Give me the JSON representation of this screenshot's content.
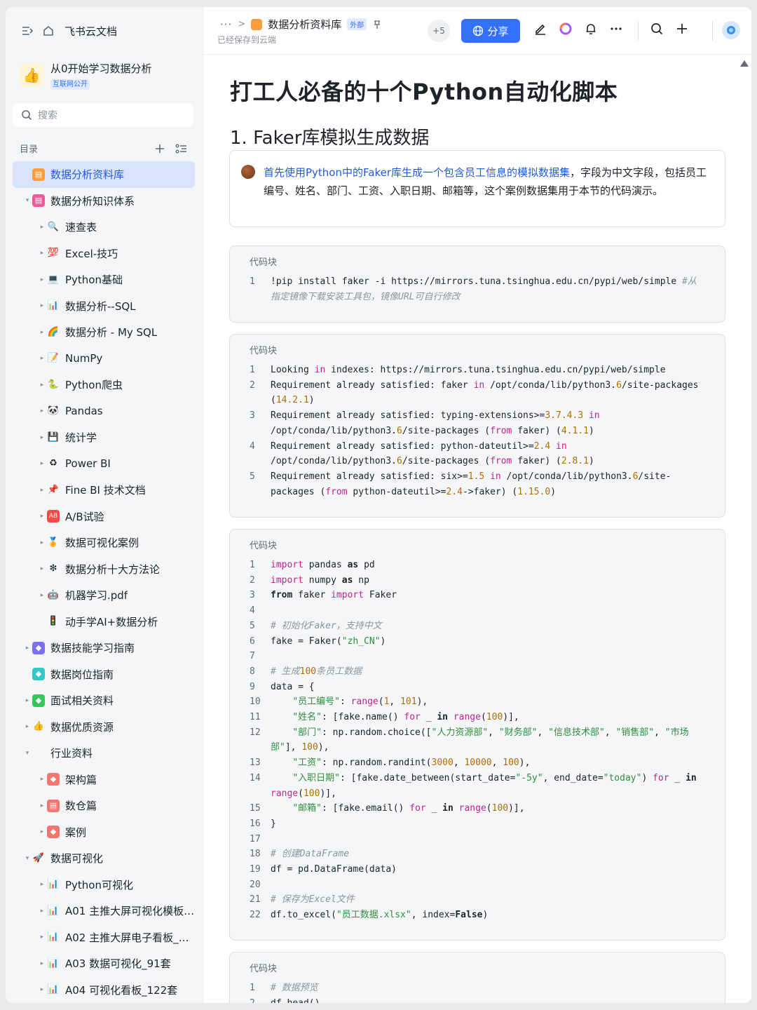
{
  "sidebar": {
    "brand": "飞书云文档",
    "space_title": "从0开始学习数据分析",
    "space_tag": "互联网公开",
    "search_placeholder": "搜索",
    "toc_label": "目录",
    "items": [
      {
        "label": "数据分析资料库",
        "level": 0,
        "caret": "",
        "emoji": "▤",
        "emoji_bg": "#ff9d3c",
        "active": true
      },
      {
        "label": "数据分析知识体系",
        "level": 0,
        "caret": "▾",
        "emoji": "▤",
        "emoji_bg": "#f05a9a",
        "active": false
      },
      {
        "label": "速查表",
        "level": 1,
        "caret": "▸",
        "emoji": "🔍",
        "emoji_bg": "",
        "active": false
      },
      {
        "label": "Excel-技巧",
        "level": 1,
        "caret": "▸",
        "emoji": "💯",
        "emoji_bg": "",
        "active": false
      },
      {
        "label": "Python基础",
        "level": 1,
        "caret": "▸",
        "emoji": "💻",
        "emoji_bg": "",
        "active": false
      },
      {
        "label": "数据分析--SQL",
        "level": 1,
        "caret": "▸",
        "emoji": "📊",
        "emoji_bg": "",
        "active": false
      },
      {
        "label": "数据分析 - My SQL",
        "level": 1,
        "caret": "▸",
        "emoji": "🌈",
        "emoji_bg": "",
        "active": false
      },
      {
        "label": "NumPy",
        "level": 1,
        "caret": "▸",
        "emoji": "📝",
        "emoji_bg": "",
        "active": false
      },
      {
        "label": "Python爬虫",
        "level": 1,
        "caret": "▸",
        "emoji": "🐍",
        "emoji_bg": "",
        "active": false
      },
      {
        "label": "Pandas",
        "level": 1,
        "caret": "▸",
        "emoji": "🐼",
        "emoji_bg": "",
        "active": false
      },
      {
        "label": "统计学",
        "level": 1,
        "caret": "▸",
        "emoji": "💾",
        "emoji_bg": "",
        "active": false
      },
      {
        "label": "Power BI",
        "level": 1,
        "caret": "▸",
        "emoji": "♻",
        "emoji_bg": "",
        "active": false
      },
      {
        "label": "Fine BI 技术文档",
        "level": 1,
        "caret": "▸",
        "emoji": "📌",
        "emoji_bg": "",
        "active": false
      },
      {
        "label": "A/B试验",
        "level": 1,
        "caret": "▸",
        "emoji": "AB",
        "emoji_bg": "#f54a45",
        "active": false
      },
      {
        "label": "数据可视化案例",
        "level": 1,
        "caret": "▸",
        "emoji": "🏅",
        "emoji_bg": "",
        "active": false
      },
      {
        "label": "数据分析十大方法论",
        "level": 1,
        "caret": "▸",
        "emoji": "❇",
        "emoji_bg": "",
        "active": false
      },
      {
        "label": "机器学习.pdf",
        "level": 1,
        "caret": "▸",
        "emoji": "🤖",
        "emoji_bg": "",
        "active": false
      },
      {
        "label": "动手学AI+数据分析",
        "level": 1,
        "caret": "",
        "emoji": "🚦",
        "emoji_bg": "",
        "active": false
      },
      {
        "label": "数据技能学习指南",
        "level": 0,
        "caret": "▸",
        "emoji": "◆",
        "emoji_bg": "#7f6ef5",
        "active": false
      },
      {
        "label": "数据岗位指南",
        "level": 0,
        "caret": "",
        "emoji": "◆",
        "emoji_bg": "#34c7c7",
        "active": false
      },
      {
        "label": "面试相关资料",
        "level": 0,
        "caret": "▸",
        "emoji": "◆",
        "emoji_bg": "#34c759",
        "active": false
      },
      {
        "label": "数据优质资源",
        "level": 0,
        "caret": "▸",
        "emoji": "👍",
        "emoji_bg": "",
        "active": false
      },
      {
        "label": "行业资料",
        "level": 0,
        "caret": "▾",
        "emoji": "",
        "emoji_bg": "",
        "active": false
      },
      {
        "label": "架构篇",
        "level": 1,
        "caret": "▸",
        "emoji": "◆",
        "emoji_bg": "#f5766e",
        "active": false
      },
      {
        "label": "数仓篇",
        "level": 1,
        "caret": "▸",
        "emoji": "▤",
        "emoji_bg": "#f5766e",
        "active": false
      },
      {
        "label": "案例",
        "level": 1,
        "caret": "▸",
        "emoji": "◆",
        "emoji_bg": "#f5766e",
        "active": false
      },
      {
        "label": "数据可视化",
        "level": 0,
        "caret": "▾",
        "emoji": "🚀",
        "emoji_bg": "",
        "active": false
      },
      {
        "label": "Python可视化",
        "level": 1,
        "caret": "▸",
        "emoji": "📊",
        "emoji_bg": "",
        "active": false
      },
      {
        "label": "A01 主推大屏可视化模板_...",
        "level": 1,
        "caret": "▸",
        "emoji": "📊",
        "emoji_bg": "",
        "active": false
      },
      {
        "label": "A02 主推大屏电子看板_20套",
        "level": 1,
        "caret": "▸",
        "emoji": "📊",
        "emoji_bg": "",
        "active": false
      },
      {
        "label": "A03 数据可视化_91套",
        "level": 1,
        "caret": "▸",
        "emoji": "📊",
        "emoji_bg": "",
        "active": false
      },
      {
        "label": "A04 可视化看板_122套",
        "level": 1,
        "caret": "▸",
        "emoji": "📊",
        "emoji_bg": "",
        "active": false
      }
    ]
  },
  "header": {
    "more": "···",
    "breadcrumb_title": "数据分析资料库",
    "external_tag": "外部",
    "saved_status": "已经保存到云端",
    "collaborators": "+5",
    "share_label": "分享"
  },
  "doc": {
    "title": "打工人必备的十个Python自动化脚本",
    "heading": "1. Faker库模拟生成数据",
    "callout_link": "首先使用Python中的Faker库生成一个包含员工信息的模拟数据集",
    "callout_rest": "，字段为中文字段，包括员工编号、姓名、部门、工资、入职日期、邮箱等，这个案例数据集用于本节的代码演示。",
    "code_title": "代码块"
  },
  "colors": {
    "accent": "#3370ff",
    "keyword": "#c0258f",
    "string": "#2f8f3d",
    "number": "#b26f00",
    "comment": "#8f959e"
  },
  "code_blocks": [
    {
      "lines": [
        {
          "n": "1",
          "t": [
            [
              "!pip install faker -i https://mirrors.tuna.tsinghua.edu.cn/pypi/web/simple ",
              ""
            ],
            [
              "#从指定镜像下载安装工具包，镜像URL可自行修改",
              "cm"
            ]
          ]
        }
      ]
    },
    {
      "lines": [
        {
          "n": "1",
          "t": [
            [
              "Looking ",
              ""
            ],
            [
              "in",
              "kw"
            ],
            [
              " indexes: https://mirrors.tuna.tsinghua.edu.cn/pypi/web/simple",
              ""
            ]
          ]
        },
        {
          "n": "2",
          "t": [
            [
              "Requirement already satisfied: faker ",
              ""
            ],
            [
              "in",
              "kw"
            ],
            [
              " /opt/conda/lib/python3.",
              ""
            ],
            [
              "6",
              "num"
            ],
            [
              "/site-packages (",
              ""
            ],
            [
              "14.2.1",
              "num"
            ],
            [
              ")",
              ""
            ]
          ]
        },
        {
          "n": "3",
          "t": [
            [
              "Requirement already satisfied: typing-extensions>=",
              ""
            ],
            [
              "3.7.4.3",
              "num"
            ],
            [
              " ",
              ""
            ],
            [
              "in",
              "kw"
            ],
            [
              " /opt/conda/lib/python3.",
              ""
            ],
            [
              "6",
              "num"
            ],
            [
              "/site-packages (",
              ""
            ],
            [
              "from",
              "kw"
            ],
            [
              " faker) (",
              ""
            ],
            [
              "4.1.1",
              "num"
            ],
            [
              ")",
              ""
            ]
          ]
        },
        {
          "n": "4",
          "t": [
            [
              "Requirement already satisfied: python-dateutil>=",
              ""
            ],
            [
              "2.4",
              "num"
            ],
            [
              " ",
              ""
            ],
            [
              "in",
              "kw"
            ],
            [
              " /opt/conda/lib/python3.",
              ""
            ],
            [
              "6",
              "num"
            ],
            [
              "/site-packages (",
              ""
            ],
            [
              "from",
              "kw"
            ],
            [
              " faker) (",
              ""
            ],
            [
              "2.8.1",
              "num"
            ],
            [
              ")",
              ""
            ]
          ]
        },
        {
          "n": "5",
          "t": [
            [
              "Requirement already satisfied: six>=",
              ""
            ],
            [
              "1.5",
              "num"
            ],
            [
              " ",
              ""
            ],
            [
              "in",
              "kw"
            ],
            [
              " /opt/conda/lib/python3.",
              ""
            ],
            [
              "6",
              "num"
            ],
            [
              "/site-packages (",
              ""
            ],
            [
              "from",
              "kw"
            ],
            [
              " python-dateutil>=",
              ""
            ],
            [
              "2.4",
              "num"
            ],
            [
              "->faker) (",
              ""
            ],
            [
              "1.15.0",
              "num"
            ],
            [
              ")",
              ""
            ]
          ]
        }
      ]
    },
    {
      "lines": [
        {
          "n": "1",
          "t": [
            [
              "import",
              "kw"
            ],
            [
              " pandas ",
              ""
            ],
            [
              "as",
              "b"
            ],
            [
              " pd",
              ""
            ]
          ]
        },
        {
          "n": "2",
          "t": [
            [
              "import",
              "kw"
            ],
            [
              " numpy ",
              ""
            ],
            [
              "as",
              "b"
            ],
            [
              " np",
              ""
            ]
          ]
        },
        {
          "n": "3",
          "t": [
            [
              "from",
              "b"
            ],
            [
              " faker ",
              ""
            ],
            [
              "import",
              "kw"
            ],
            [
              " Faker",
              ""
            ]
          ]
        },
        {
          "n": "4",
          "t": [
            [
              "",
              ""
            ]
          ]
        },
        {
          "n": "5",
          "t": [
            [
              "# 初始化Faker，支持中文",
              "cm"
            ]
          ]
        },
        {
          "n": "6",
          "t": [
            [
              "fake = Faker(",
              ""
            ],
            [
              "\"zh_CN\"",
              "str"
            ],
            [
              ")",
              ""
            ]
          ]
        },
        {
          "n": "7",
          "t": [
            [
              "",
              ""
            ]
          ]
        },
        {
          "n": "8",
          "t": [
            [
              "# 生成",
              "cm"
            ],
            [
              "100",
              "num"
            ],
            [
              "条员工数据",
              "cm"
            ]
          ]
        },
        {
          "n": "9",
          "t": [
            [
              "data = {",
              ""
            ]
          ]
        },
        {
          "n": "10",
          "t": [
            [
              "    ",
              ""
            ],
            [
              "\"员工编号\"",
              "str"
            ],
            [
              ": ",
              ""
            ],
            [
              "range",
              "kw"
            ],
            [
              "(",
              ""
            ],
            [
              "1",
              "num"
            ],
            [
              ", ",
              ""
            ],
            [
              "101",
              "num"
            ],
            [
              "),",
              ""
            ]
          ]
        },
        {
          "n": "11",
          "t": [
            [
              "    ",
              ""
            ],
            [
              "\"姓名\"",
              "str"
            ],
            [
              ": [fake.name() ",
              ""
            ],
            [
              "for",
              "kw"
            ],
            [
              " _ ",
              ""
            ],
            [
              "in",
              "b"
            ],
            [
              " ",
              ""
            ],
            [
              "range",
              "kw"
            ],
            [
              "(",
              ""
            ],
            [
              "100",
              "num"
            ],
            [
              ")],",
              ""
            ]
          ]
        },
        {
          "n": "12",
          "t": [
            [
              "    ",
              ""
            ],
            [
              "\"部门\"",
              "str"
            ],
            [
              ": np.random.choice([",
              ""
            ],
            [
              "\"人力资源部\"",
              "str"
            ],
            [
              ", ",
              ""
            ],
            [
              "\"财务部\"",
              "str"
            ],
            [
              ", ",
              ""
            ],
            [
              "\"信息技术部\"",
              "str"
            ],
            [
              ", ",
              ""
            ],
            [
              "\"销售部\"",
              "str"
            ],
            [
              ", ",
              ""
            ],
            [
              "\"市场部\"",
              "str"
            ],
            [
              "], ",
              ""
            ],
            [
              "100",
              "num"
            ],
            [
              "),",
              ""
            ]
          ]
        },
        {
          "n": "13",
          "t": [
            [
              "    ",
              ""
            ],
            [
              "\"工资\"",
              "str"
            ],
            [
              ": np.random.randint(",
              ""
            ],
            [
              "3000",
              "num"
            ],
            [
              ", ",
              ""
            ],
            [
              "10000",
              "num"
            ],
            [
              ", ",
              ""
            ],
            [
              "100",
              "num"
            ],
            [
              "),",
              ""
            ]
          ]
        },
        {
          "n": "14",
          "t": [
            [
              "    ",
              ""
            ],
            [
              "\"入职日期\"",
              "str"
            ],
            [
              ": [fake.date_between(start_date=",
              ""
            ],
            [
              "\"-5y\"",
              "str"
            ],
            [
              ", end_date=",
              ""
            ],
            [
              "\"today\"",
              "str"
            ],
            [
              ") ",
              ""
            ],
            [
              "for",
              "kw"
            ],
            [
              " _ ",
              ""
            ],
            [
              "in",
              "b"
            ],
            [
              " ",
              ""
            ],
            [
              "range",
              "kw"
            ],
            [
              "(",
              ""
            ],
            [
              "100",
              "num"
            ],
            [
              ")],",
              ""
            ]
          ]
        },
        {
          "n": "15",
          "t": [
            [
              "    ",
              ""
            ],
            [
              "\"邮箱\"",
              "str"
            ],
            [
              ": [fake.email() ",
              ""
            ],
            [
              "for",
              "kw"
            ],
            [
              " _ ",
              ""
            ],
            [
              "in",
              "b"
            ],
            [
              " ",
              ""
            ],
            [
              "range",
              "kw"
            ],
            [
              "(",
              ""
            ],
            [
              "100",
              "num"
            ],
            [
              ")],",
              ""
            ]
          ]
        },
        {
          "n": "16",
          "t": [
            [
              "}",
              ""
            ]
          ]
        },
        {
          "n": "17",
          "t": [
            [
              "",
              ""
            ]
          ]
        },
        {
          "n": "18",
          "t": [
            [
              "# 创建DataFrame",
              "cm"
            ]
          ]
        },
        {
          "n": "19",
          "t": [
            [
              "df = pd.DataFrame(data)",
              ""
            ]
          ]
        },
        {
          "n": "20",
          "t": [
            [
              "",
              ""
            ]
          ]
        },
        {
          "n": "21",
          "t": [
            [
              "# 保存为Excel文件",
              "cm"
            ]
          ]
        },
        {
          "n": "22",
          "t": [
            [
              "df.to_excel(",
              ""
            ],
            [
              "\"员工数据.xlsx\"",
              "str"
            ],
            [
              ", index=",
              ""
            ],
            [
              "False",
              "b"
            ],
            [
              ")",
              ""
            ]
          ]
        }
      ]
    },
    {
      "lines": [
        {
          "n": "1",
          "t": [
            [
              "# 数据预览",
              "cm"
            ]
          ]
        },
        {
          "n": "2",
          "t": [
            [
              "df.head()",
              ""
            ]
          ]
        }
      ]
    }
  ]
}
